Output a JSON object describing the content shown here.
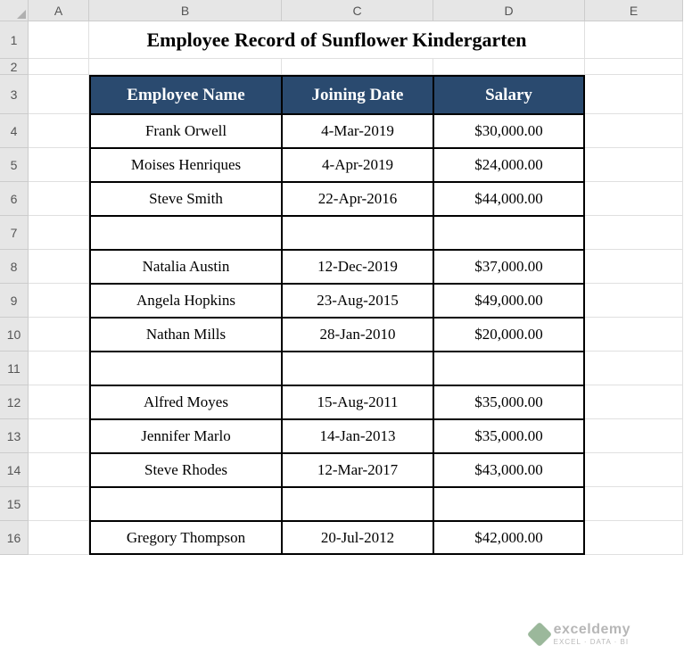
{
  "columns": [
    "A",
    "B",
    "C",
    "D",
    "E"
  ],
  "rows": [
    "1",
    "2",
    "3",
    "4",
    "5",
    "6",
    "7",
    "8",
    "9",
    "10",
    "11",
    "12",
    "13",
    "14",
    "15",
    "16"
  ],
  "title": "Employee Record of Sunflower Kindergarten",
  "headers": {
    "name": "Employee Name",
    "date": "Joining Date",
    "salary": "Salary"
  },
  "data": [
    {
      "name": "Frank Orwell",
      "date": "4-Mar-2019",
      "salary": "$30,000.00"
    },
    {
      "name": "Moises Henriques",
      "date": "4-Apr-2019",
      "salary": "$24,000.00"
    },
    {
      "name": "Steve Smith",
      "date": "22-Apr-2016",
      "salary": "$44,000.00"
    },
    {
      "name": "",
      "date": "",
      "salary": ""
    },
    {
      "name": "Natalia Austin",
      "date": "12-Dec-2019",
      "salary": "$37,000.00"
    },
    {
      "name": "Angela Hopkins",
      "date": "23-Aug-2015",
      "salary": "$49,000.00"
    },
    {
      "name": "Nathan Mills",
      "date": "28-Jan-2010",
      "salary": "$20,000.00"
    },
    {
      "name": "",
      "date": "",
      "salary": ""
    },
    {
      "name": "Alfred Moyes",
      "date": "15-Aug-2011",
      "salary": "$35,000.00"
    },
    {
      "name": "Jennifer Marlo",
      "date": "14-Jan-2013",
      "salary": "$35,000.00"
    },
    {
      "name": "Steve Rhodes",
      "date": "12-Mar-2017",
      "salary": "$43,000.00"
    },
    {
      "name": "",
      "date": "",
      "salary": ""
    },
    {
      "name": "Gregory Thompson",
      "date": "20-Jul-2012",
      "salary": "$42,000.00"
    }
  ],
  "watermark": {
    "main": "exceldemy",
    "sub": "EXCEL · DATA · BI"
  },
  "rowHeights": {
    "title": 42,
    "spacer": 18,
    "header": 44,
    "data": 38
  }
}
